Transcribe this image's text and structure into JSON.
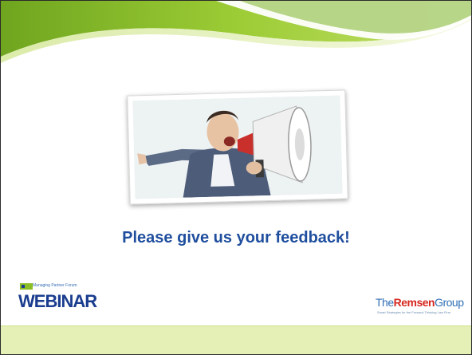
{
  "slide": {
    "heading": "Please give us your feedback!"
  },
  "logos": {
    "webinar": {
      "top_text": "Managing Partner Forum",
      "word": "WEBINAR"
    },
    "remsen": {
      "prefix": "The",
      "brand": "Remsen",
      "suffix": "Group",
      "tagline": "Smart Strategies for the Forward-Thinking Law Firm"
    }
  },
  "colors": {
    "accent_green": "#8cbf27",
    "light_green": "#e5f0b6",
    "heading_blue": "#1f4e9e"
  },
  "image": {
    "icon": "man-shouting-megaphone-photo"
  }
}
